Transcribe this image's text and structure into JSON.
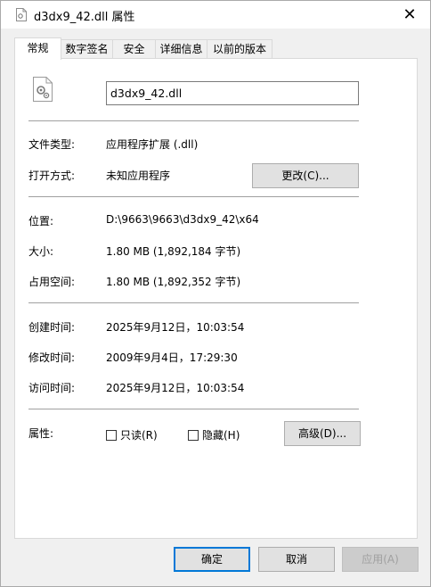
{
  "window": {
    "title": "d3dx9_42.dll 属性",
    "close_glyph": "✕"
  },
  "tabs": [
    {
      "label": "常规"
    },
    {
      "label": "数字签名"
    },
    {
      "label": "安全"
    },
    {
      "label": "详细信息"
    },
    {
      "label": "以前的版本"
    }
  ],
  "general": {
    "filename": "d3dx9_42.dll",
    "file_type_label": "文件类型:",
    "file_type_value": "应用程序扩展 (.dll)",
    "open_with_label": "打开方式:",
    "open_with_value": "未知应用程序",
    "change_button": "更改(C)...",
    "location_label": "位置:",
    "location_value": "D:\\9663\\9663\\d3dx9_42\\x64",
    "size_label": "大小:",
    "size_value": "1.80 MB (1,892,184 字节)",
    "disk_size_label": "占用空间:",
    "disk_size_value": "1.80 MB (1,892,352 字节)",
    "created_label": "创建时间:",
    "created_value": "2025年9月12日，10:03:54",
    "modified_label": "修改时间:",
    "modified_value": "2009年9月4日，17:29:30",
    "accessed_label": "访问时间:",
    "accessed_value": "2025年9月12日，10:03:54",
    "attributes_label": "属性:",
    "readonly_label": "只读(R)",
    "readonly_checked": false,
    "hidden_label": "隐藏(H)",
    "hidden_checked": false,
    "advanced_button": "高级(D)..."
  },
  "buttons": {
    "ok": "确定",
    "cancel": "取消",
    "apply": "应用(A)"
  }
}
